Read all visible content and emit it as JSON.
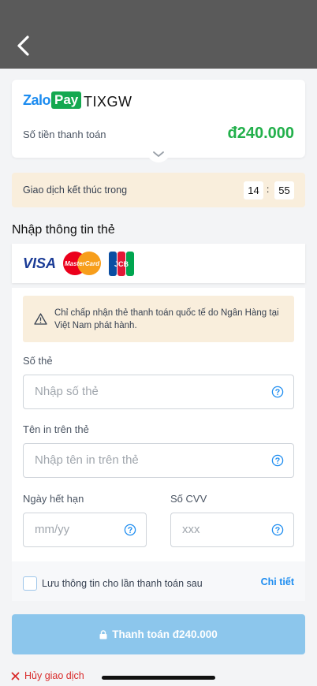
{
  "header": {
    "back_icon": "chevron-left-icon"
  },
  "order": {
    "merchant": "TIXGW",
    "amount_label": "Số tiền thanh toán",
    "amount_value": "đ240.000"
  },
  "logo": {
    "zalo": "Zalo",
    "pay": "Pay"
  },
  "timer": {
    "label": "Giao dịch kết thúc trong",
    "minutes": "14",
    "seconds": "55",
    "separator": ":"
  },
  "card_section": {
    "title": "Nhập thông tin thẻ",
    "brands": {
      "visa": "VISA",
      "mastercard": "MasterCard",
      "jcb": "JCB"
    }
  },
  "notice": {
    "text": "Chỉ chấp nhận thẻ thanh toán quốc tế do Ngân Hàng tại Việt Nam phát hành."
  },
  "form": {
    "card_number_label": "Số thẻ",
    "card_number_placeholder": "Nhập số thẻ",
    "card_name_label": "Tên in trên thẻ",
    "card_name_placeholder": "Nhập tên in trên thẻ",
    "expiry_label": "Ngày hết hạn",
    "expiry_placeholder": "mm/yy",
    "cvv_label": "Số CVV",
    "cvv_placeholder": "xxx"
  },
  "save": {
    "label": "Lưu thông tin cho lần thanh toán sau",
    "detail": "Chi tiết"
  },
  "pay_button": {
    "label": "Thanh toán đ240.000"
  },
  "cancel": {
    "label": "Hủy giao dịch"
  },
  "colors": {
    "brand_blue": "#1c8cf0",
    "amount_green": "#22b04b",
    "pay_button": "#8cc6ec",
    "cancel_red": "#d92b2b"
  }
}
